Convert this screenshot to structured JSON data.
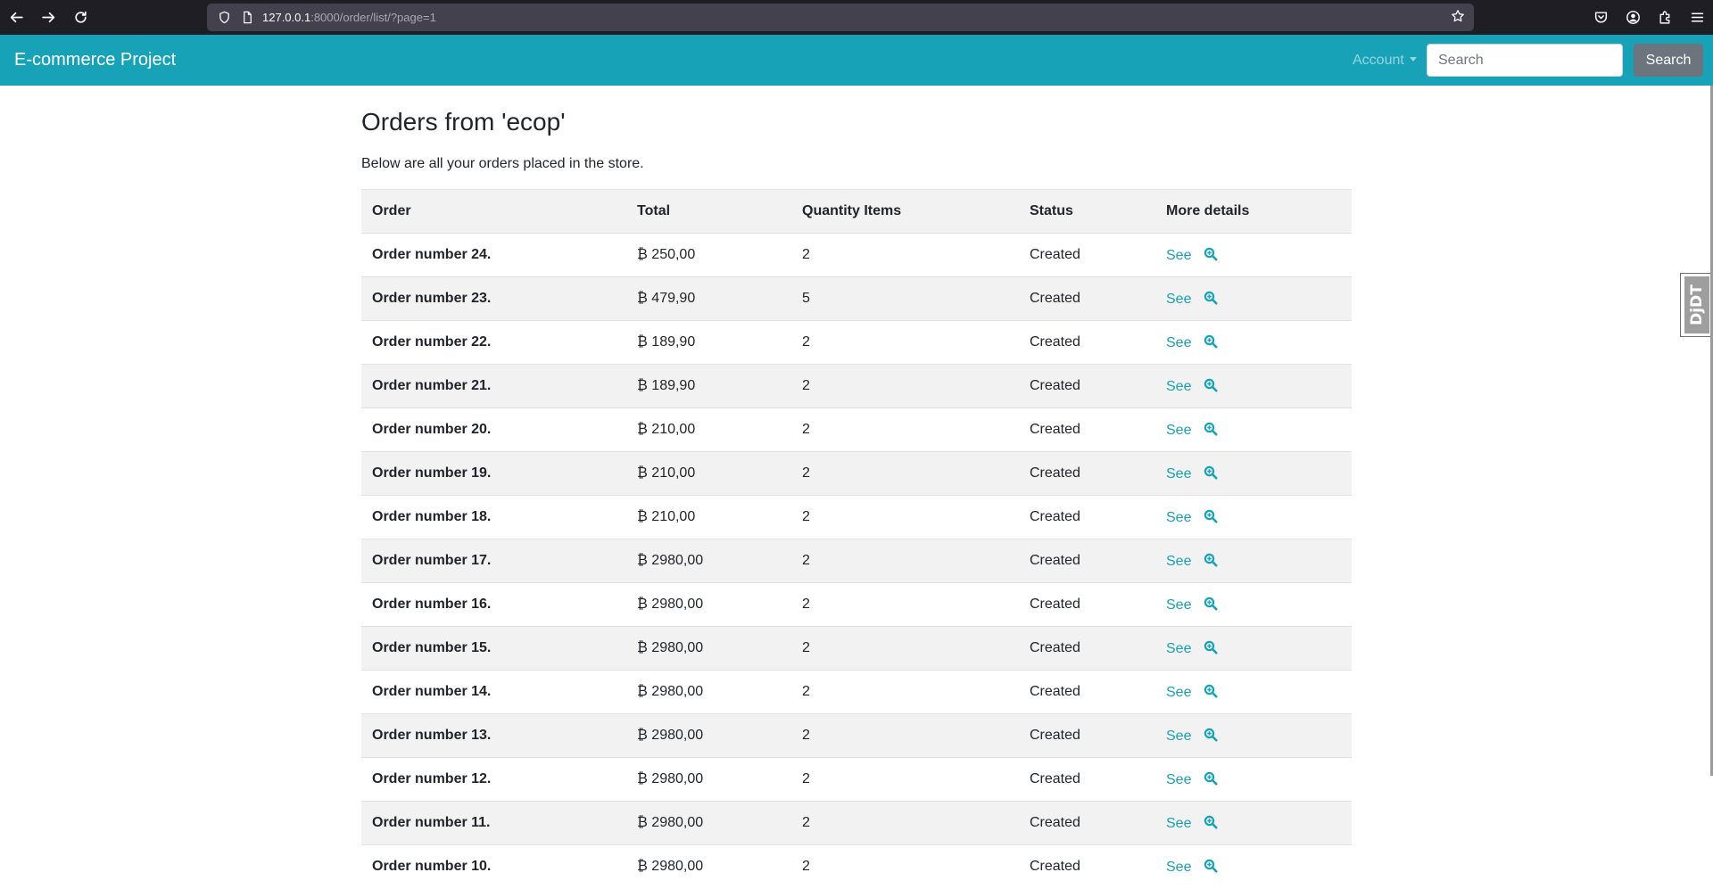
{
  "browser": {
    "url_host": "127.0.0.1",
    "url_rest": ":8000/order/list/?page=1"
  },
  "navbar": {
    "brand": "E-commerce Project",
    "account_label": "Account",
    "search_placeholder": "Search",
    "search_button": "Search"
  },
  "page": {
    "title": "Orders from 'ecop'",
    "description": "Below are all your orders placed in the store."
  },
  "table": {
    "headers": [
      "Order",
      "Total",
      "Quantity Items",
      "Status",
      "More details"
    ],
    "rows": [
      {
        "order": "Order number 24.",
        "total": "₿ 250,00",
        "qty": "2",
        "status": "Created",
        "link": "See"
      },
      {
        "order": "Order number 23.",
        "total": "₿ 479,90",
        "qty": "5",
        "status": "Created",
        "link": "See"
      },
      {
        "order": "Order number 22.",
        "total": "₿ 189,90",
        "qty": "2",
        "status": "Created",
        "link": "See"
      },
      {
        "order": "Order number 21.",
        "total": "₿ 189,90",
        "qty": "2",
        "status": "Created",
        "link": "See"
      },
      {
        "order": "Order number 20.",
        "total": "₿ 210,00",
        "qty": "2",
        "status": "Created",
        "link": "See"
      },
      {
        "order": "Order number 19.",
        "total": "₿ 210,00",
        "qty": "2",
        "status": "Created",
        "link": "See"
      },
      {
        "order": "Order number 18.",
        "total": "₿ 210,00",
        "qty": "2",
        "status": "Created",
        "link": "See"
      },
      {
        "order": "Order number 17.",
        "total": "₿ 2980,00",
        "qty": "2",
        "status": "Created",
        "link": "See"
      },
      {
        "order": "Order number 16.",
        "total": "₿ 2980,00",
        "qty": "2",
        "status": "Created",
        "link": "See"
      },
      {
        "order": "Order number 15.",
        "total": "₿ 2980,00",
        "qty": "2",
        "status": "Created",
        "link": "See"
      },
      {
        "order": "Order number 14.",
        "total": "₿ 2980,00",
        "qty": "2",
        "status": "Created",
        "link": "See"
      },
      {
        "order": "Order number 13.",
        "total": "₿ 2980,00",
        "qty": "2",
        "status": "Created",
        "link": "See"
      },
      {
        "order": "Order number 12.",
        "total": "₿ 2980,00",
        "qty": "2",
        "status": "Created",
        "link": "See"
      },
      {
        "order": "Order number 11.",
        "total": "₿ 2980,00",
        "qty": "2",
        "status": "Created",
        "link": "See"
      },
      {
        "order": "Order number 10.",
        "total": "₿ 2980,00",
        "qty": "2",
        "status": "Created",
        "link": "See"
      }
    ]
  },
  "debug_toolbar": {
    "label": "DjDT"
  },
  "colors": {
    "navbar_bg": "#17a2b8",
    "link": "#17a2b8",
    "search_button_bg": "#6c757d",
    "striped_row": "#f2f2f2"
  },
  "icons": {
    "zoom": "magnifier-plus-icon"
  }
}
